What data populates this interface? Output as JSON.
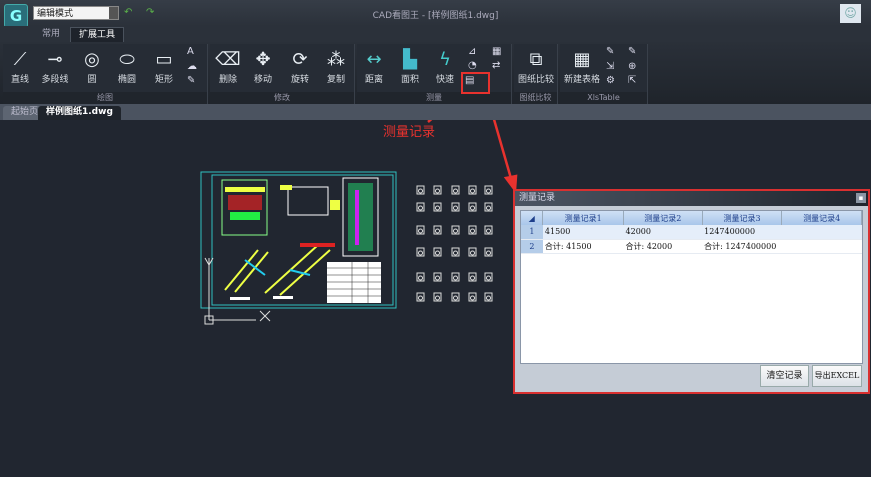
{
  "app": {
    "title": "CAD看图王 - [样例图纸1.dwg]",
    "mode": "编辑模式",
    "logo_icon": "app-logo-icon",
    "user_icon": "user-icon"
  },
  "ribbon_tabs": [
    {
      "label": "常用",
      "active": false
    },
    {
      "label": "扩展工具",
      "active": true
    }
  ],
  "groups": {
    "draw": {
      "label": "绘图",
      "tools": [
        {
          "label": "直线",
          "icon": "line-icon"
        },
        {
          "label": "多段线",
          "icon": "polyline-icon"
        },
        {
          "label": "圆",
          "icon": "circle-icon"
        },
        {
          "label": "椭圆",
          "icon": "ellipse-icon"
        },
        {
          "label": "矩形",
          "icon": "rectangle-icon"
        }
      ],
      "small": [
        "text-icon",
        "cloud-icon",
        "sketch-icon"
      ]
    },
    "modify": {
      "label": "修改",
      "tools": [
        {
          "label": "删除",
          "icon": "eraser-icon"
        },
        {
          "label": "移动",
          "icon": "move-icon"
        },
        {
          "label": "旋转",
          "icon": "rotate-icon"
        },
        {
          "label": "复制",
          "icon": "copy-icon"
        }
      ]
    },
    "measure": {
      "label": "测量",
      "tools": [
        {
          "label": "距离",
          "icon": "distance-icon"
        },
        {
          "label": "面积",
          "icon": "area-icon"
        },
        {
          "label": "快速",
          "icon": "quick-measure-icon"
        }
      ]
    },
    "compare": {
      "label": "图纸比较",
      "tools": [
        {
          "label": "图纸比较",
          "icon": "compare-icon"
        }
      ]
    },
    "xls": {
      "label": "XlsTable",
      "tools": [
        {
          "label": "新建表格",
          "icon": "new-table-icon"
        }
      ]
    }
  },
  "doc_tabs": [
    {
      "label": "起始页",
      "active": false
    },
    {
      "label": "样例图纸1.dwg",
      "active": true
    }
  ],
  "annotation": {
    "text": "测量记录",
    "color": "#e8322e"
  },
  "dialog": {
    "title": "测量记录",
    "columns": [
      "测量记录1",
      "测量记录2",
      "测量记录3",
      "测量记录4"
    ],
    "rows": [
      {
        "n": "1",
        "cells": [
          "41500",
          "42000",
          "1247400000",
          ""
        ]
      },
      {
        "n": "2",
        "cells": [
          "合计: 41500",
          "合计: 42000",
          "合计: 1247400000",
          ""
        ]
      }
    ],
    "buttons": {
      "clear": "清空记录",
      "export": "导出EXCEL"
    }
  }
}
